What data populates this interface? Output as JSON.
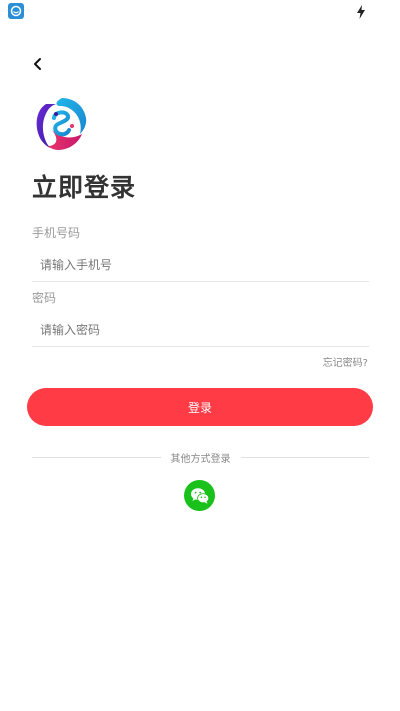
{
  "colors": {
    "accent": "#ff3b45",
    "wechat": "#19c11a",
    "title": "#333333",
    "label": "#999999",
    "status_app_icon": "#2a8fd6"
  },
  "status_bar": {
    "app_icon": "app-icon",
    "charging_icon": "lightning-icon"
  },
  "header": {
    "back_icon": "chevron-left-icon",
    "title": "立即登录"
  },
  "form": {
    "phone": {
      "label": "手机号码",
      "placeholder": "请输入手机号",
      "value": ""
    },
    "password": {
      "label": "密码",
      "placeholder": "请输入密码",
      "value": ""
    },
    "forgot_label": "忘记密码?",
    "submit_label": "登录"
  },
  "other_login": {
    "label": "其他方式登录",
    "methods": [
      {
        "icon": "wechat-icon"
      }
    ]
  }
}
